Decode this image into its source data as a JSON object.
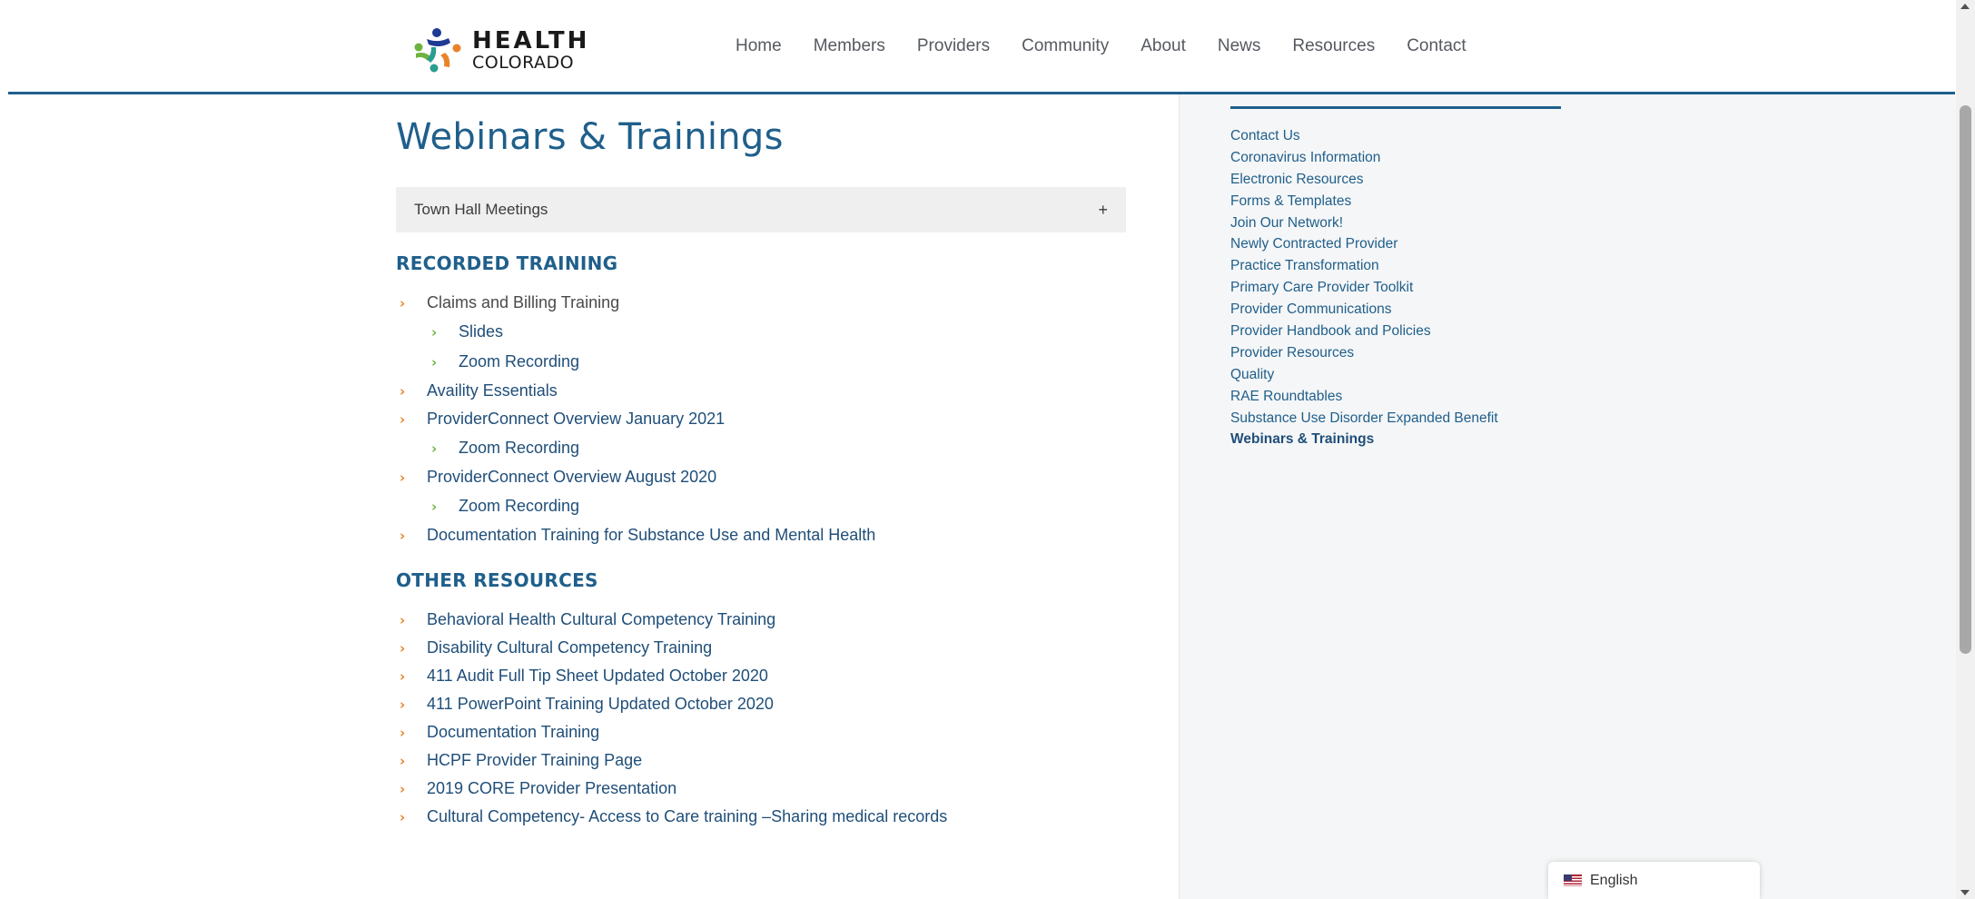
{
  "logo": {
    "line1": "HEALTH",
    "line2": "COLORADO"
  },
  "nav": [
    "Home",
    "Members",
    "Providers",
    "Community",
    "About",
    "News",
    "Resources",
    "Contact"
  ],
  "page_title": "Webinars & Trainings",
  "accordion": {
    "label": "Town Hall Meetings",
    "toggle": "+"
  },
  "recorded_training": {
    "heading": "RECORDED TRAINING",
    "items": [
      {
        "label": "Claims and Billing Training",
        "level": 1,
        "style": "dark"
      },
      {
        "label": "Slides",
        "level": 2
      },
      {
        "label": "Zoom Recording",
        "level": 2
      },
      {
        "label": "Availity Essentials",
        "level": 1
      },
      {
        "label": "ProviderConnect Overview January 2021",
        "level": 1
      },
      {
        "label": "Zoom Recording",
        "level": 2
      },
      {
        "label": "ProviderConnect Overview August 2020",
        "level": 1
      },
      {
        "label": "Zoom Recording",
        "level": 2
      },
      {
        "label": "Documentation Training for Substance Use and Mental Health",
        "level": 1
      }
    ]
  },
  "other_resources": {
    "heading": "OTHER RESOURCES",
    "items": [
      "Behavioral Health Cultural Competency Training",
      "Disability Cultural Competency Training",
      "411 Audit Full Tip Sheet Updated October 2020",
      "411 PowerPoint Training Updated October 2020",
      "Documentation Training",
      "HCPF Provider Training Page",
      "2019 CORE Provider Presentation",
      "Cultural Competency- Access to Care training –Sharing medical records"
    ]
  },
  "sidebar": {
    "items": [
      "Contact Us",
      "Coronavirus Information",
      "Electronic Resources",
      "Forms & Templates",
      "Join Our Network!",
      "Newly Contracted Provider",
      "Practice Transformation",
      "Primary Care Provider Toolkit",
      "Provider Communications",
      "Provider Handbook and Policies",
      "Provider Resources",
      "Quality",
      "RAE Roundtables",
      "Substance Use Disorder Expanded Benefit",
      "Webinars & Trainings"
    ],
    "active_index": 14
  },
  "language": {
    "label": "English",
    "flag_icon": "us-flag-icon"
  },
  "colors": {
    "brand_blue": "#1f5f8b",
    "bullet_orange": "#e8832a",
    "bullet_green": "#6db33f",
    "accordion_bg": "#efefef",
    "sidebar_bg": "#f5f6f7"
  }
}
